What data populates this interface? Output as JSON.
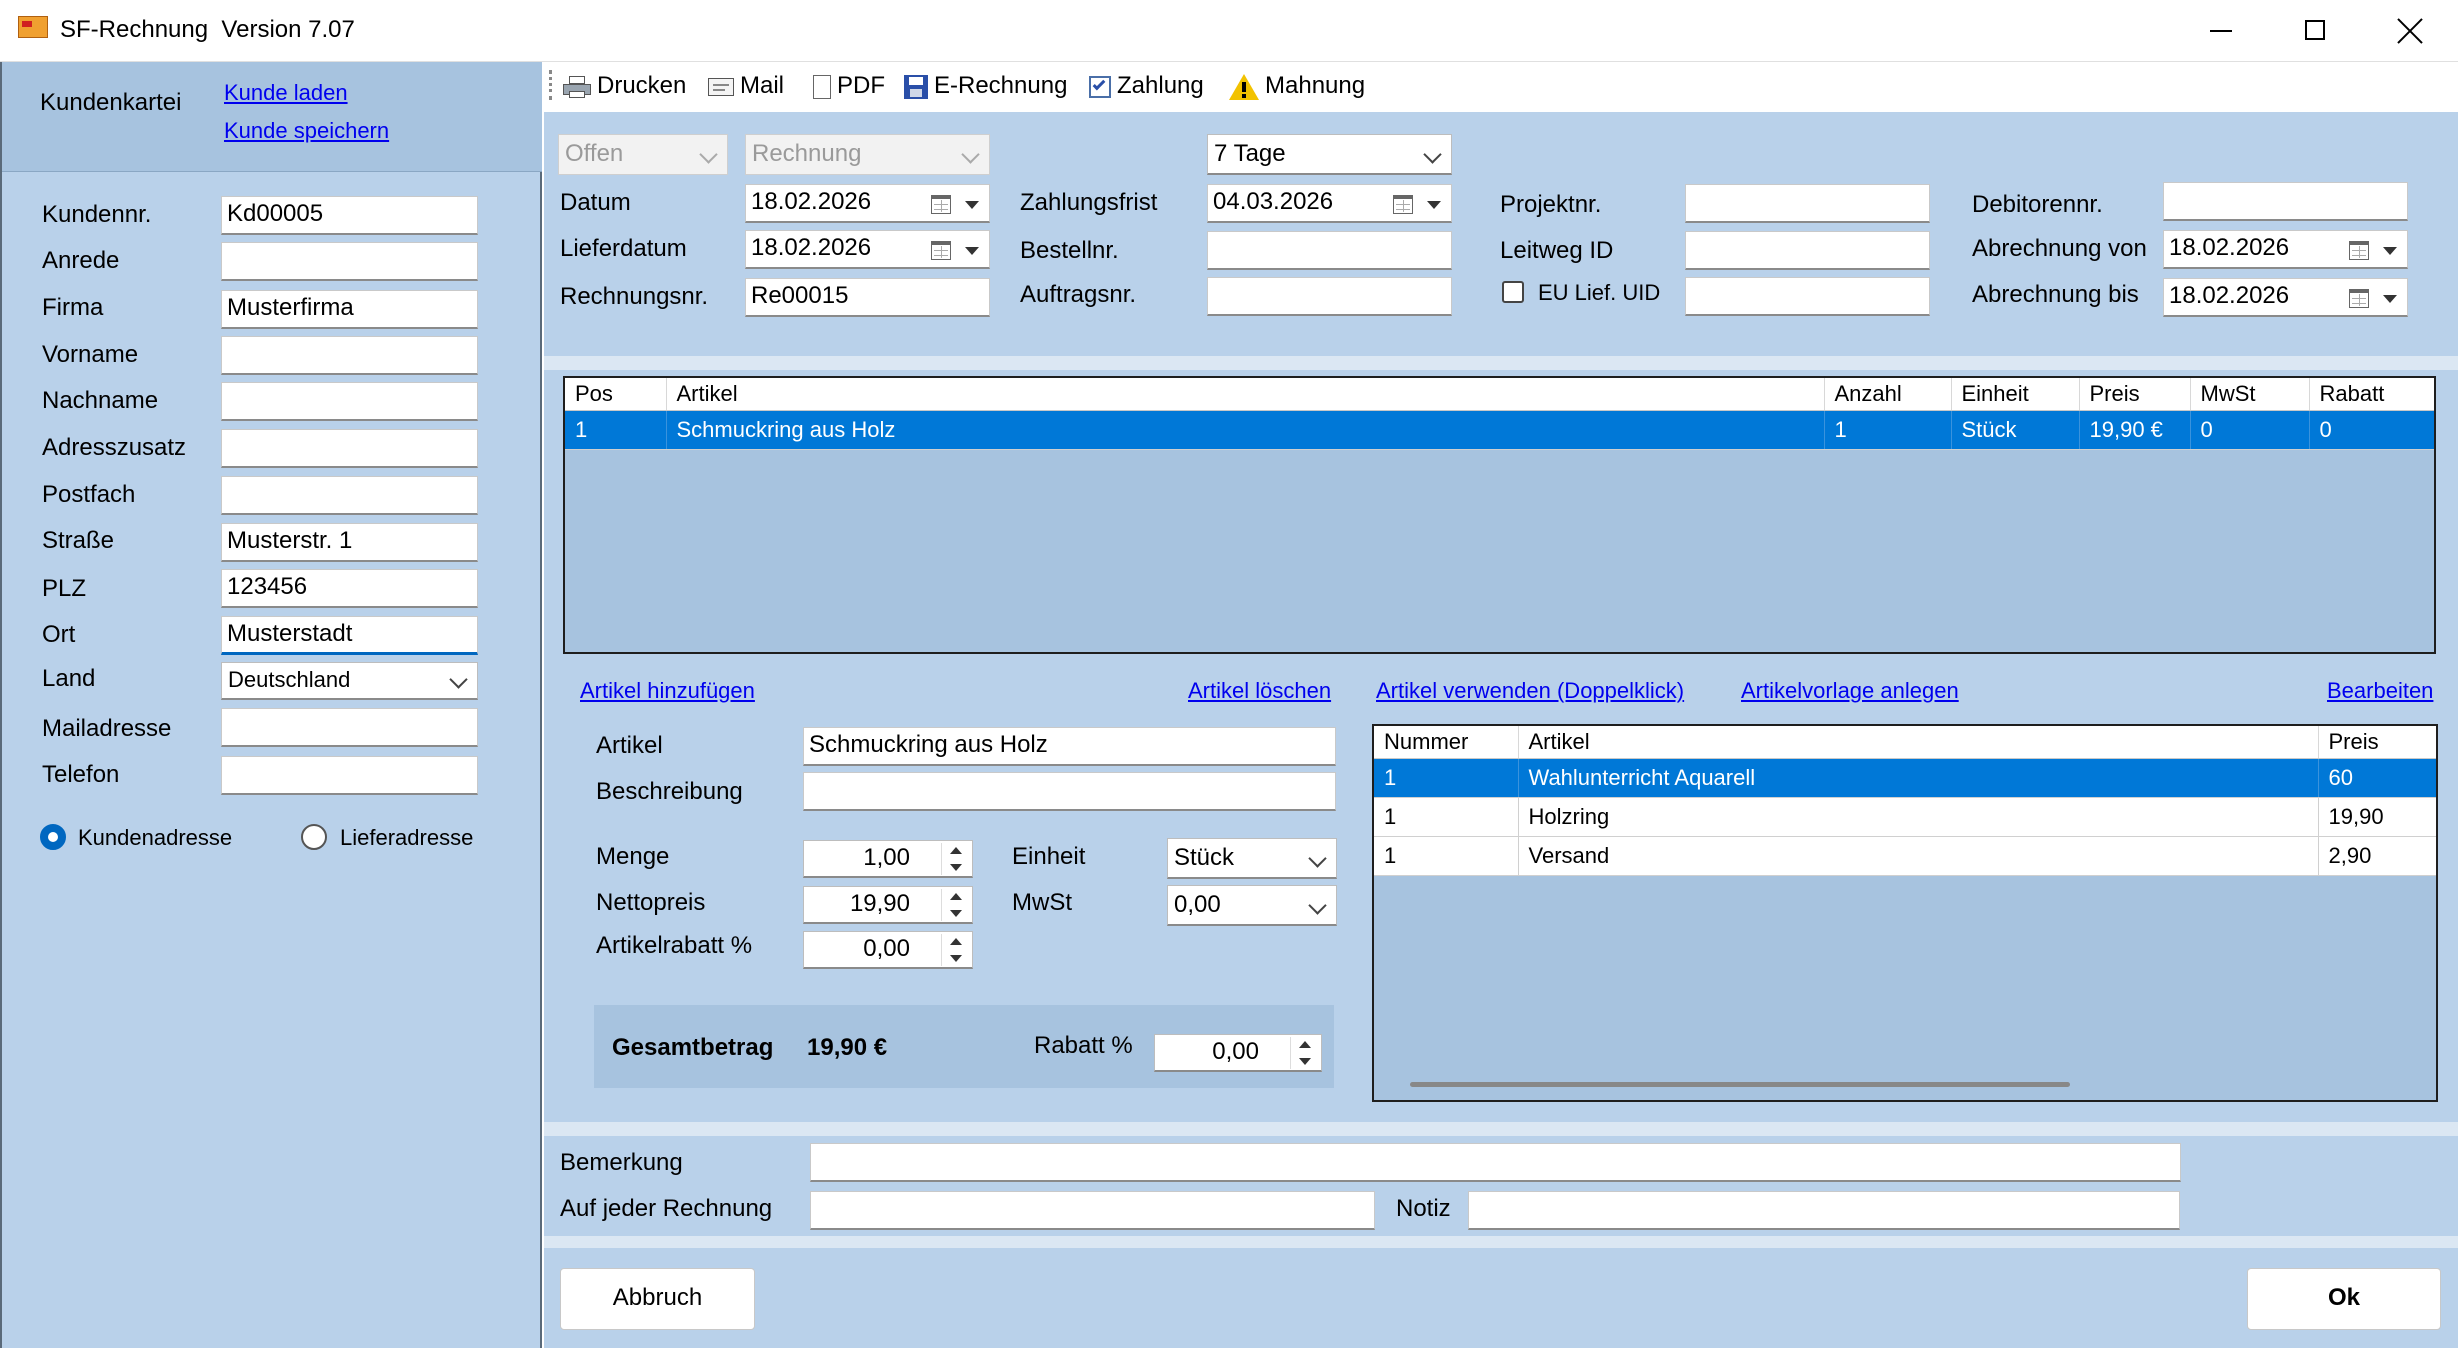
{
  "window": {
    "title": "SF-Rechnung  Version 7.07"
  },
  "customer": {
    "section_label": "Kundenkartei",
    "load_link": "Kunde laden",
    "save_link": "Kunde speichern",
    "fields": {
      "kundennr": {
        "label": "Kundennr.",
        "value": "Kd00005"
      },
      "anrede": {
        "label": "Anrede",
        "value": ""
      },
      "firma": {
        "label": "Firma",
        "value": "Musterfirma"
      },
      "vorname": {
        "label": "Vorname",
        "value": ""
      },
      "nachname": {
        "label": "Nachname",
        "value": ""
      },
      "adresszusatz": {
        "label": "Adresszusatz",
        "value": ""
      },
      "postfach": {
        "label": "Postfach",
        "value": ""
      },
      "strasse": {
        "label": "Straße",
        "value": "Musterstr. 1"
      },
      "plz": {
        "label": "PLZ",
        "value": "123456"
      },
      "ort": {
        "label": "Ort",
        "value": "Musterstadt"
      },
      "land": {
        "label": "Land",
        "value": "Deutschland"
      },
      "mail": {
        "label": "Mailadresse",
        "value": ""
      },
      "telefon": {
        "label": "Telefon",
        "value": ""
      }
    },
    "radio_kunde": "Kundenadresse",
    "radio_liefer": "Lieferadresse"
  },
  "toolbar": {
    "print": "Drucken",
    "mail": "Mail",
    "pdf": "PDF",
    "erechnung": "E-Rechnung",
    "zahlung": "Zahlung",
    "mahnung": "Mahnung"
  },
  "invoice": {
    "status": "Offen",
    "doc_type": "Rechnung",
    "payment_terms": "7 Tage",
    "datum_label": "Datum",
    "datum": "18.02.2026",
    "lieferdatum_label": "Lieferdatum",
    "lieferdatum": "18.02.2026",
    "rechnungsnr_label": "Rechnungsnr.",
    "rechnungsnr": "Re00015",
    "zahlungsfrist_label": "Zahlungsfrist",
    "zahlungsfrist": "04.03.2026",
    "bestellnr_label": "Bestellnr.",
    "bestellnr": "",
    "auftragsnr_label": "Auftragsnr.",
    "auftragsnr": "",
    "projektnr_label": "Projektnr.",
    "projektnr": "",
    "leitweg_label": "Leitweg ID",
    "leitweg": "",
    "eu_uid_label": "EU Lief. UID",
    "eu_uid": "",
    "debitoren_label": "Debitorennr.",
    "debitoren": "",
    "abrechnung_von_label": "Abrechnung von",
    "abrechnung_von": "18.02.2026",
    "abrechnung_bis_label": "Abrechnung bis",
    "abrechnung_bis": "18.02.2026"
  },
  "positions": {
    "headers": {
      "pos": "Pos",
      "artikel": "Artikel",
      "anzahl": "Anzahl",
      "einheit": "Einheit",
      "preis": "Preis",
      "mwst": "MwSt",
      "rabatt": "Rabatt"
    },
    "rows": [
      {
        "pos": "1",
        "artikel": "Schmuckring aus Holz",
        "anzahl": "1",
        "einheit": "Stück",
        "preis": "19,90 €",
        "mwst": "0",
        "rabatt": "0"
      }
    ]
  },
  "article_links": {
    "add": "Artikel hinzufügen",
    "delete": "Artikel löschen",
    "use": "Artikel verwenden (Doppelklick)",
    "template": "Artikelvorlage anlegen",
    "edit": "Bearbeiten"
  },
  "article_form": {
    "artikel_label": "Artikel",
    "artikel": "Schmuckring aus Holz",
    "beschreibung_label": "Beschreibung",
    "beschreibung": "",
    "menge_label": "Menge",
    "menge": "1,00",
    "nettopreis_label": "Nettopreis",
    "nettopreis": "19,90",
    "rabatt_label": "Artikelrabatt %",
    "rabatt": "0,00",
    "einheit_label": "Einheit",
    "einheit": "Stück",
    "mwst_label": "MwSt",
    "mwst": "0,00"
  },
  "total": {
    "label": "Gesamtbetrag",
    "value": "19,90 €",
    "rabatt_label": "Rabatt %",
    "rabatt": "0,00"
  },
  "catalog": {
    "headers": {
      "nummer": "Nummer",
      "artikel": "Artikel",
      "preis": "Preis"
    },
    "rows": [
      {
        "nummer": "1",
        "artikel": "Wahlunterricht Aquarell",
        "preis": "60"
      },
      {
        "nummer": "1",
        "artikel": "Holzring",
        "preis": "19,90"
      },
      {
        "nummer": "1",
        "artikel": "Versand",
        "preis": "2,90"
      }
    ]
  },
  "notes": {
    "bemerkung_label": "Bemerkung",
    "bemerkung": "",
    "jeder_label": "Auf jeder Rechnung",
    "jeder": "",
    "notiz_label": "Notiz",
    "notiz": ""
  },
  "buttons": {
    "cancel": "Abbruch",
    "ok": "Ok"
  },
  "colors": {
    "panel": "#b9d1ea",
    "panel_header": "#a7c3df",
    "selection": "#0078d7",
    "link": "#0000ee"
  }
}
